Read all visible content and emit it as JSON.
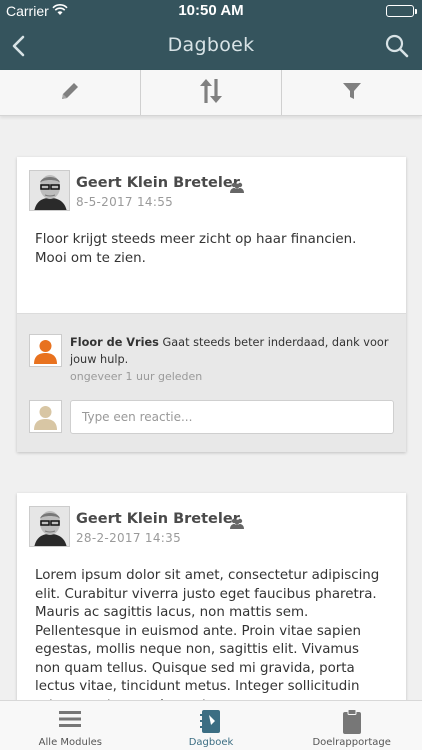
{
  "status_bar": {
    "carrier": "Carrier",
    "time": "10:50 AM",
    "battery_level": 1.0
  },
  "navbar": {
    "title": "Dagboek"
  },
  "colors": {
    "header": "#35545d",
    "accent": "#3c6e83",
    "success": "#4cd964"
  },
  "posts": [
    {
      "author": "Geert Klein Breteler",
      "date": "8-5-2017 14:55",
      "body": "Floor krijgt steeds meer zicht op haar financien. Mooi om te zien.",
      "comments": [
        {
          "author": "Floor de Vries",
          "text": "Gaat steeds beter inderdaad, dank voor jouw hulp.",
          "time": "ongeveer 1 uur geleden"
        }
      ],
      "reply_placeholder": "Type een reactie..."
    },
    {
      "author": "Geert Klein Breteler",
      "date": "28-2-2017 14:35",
      "body": "Lorem ipsum dolor sit amet, consectetur adipiscing elit. Curabitur viverra justo eget faucibus pharetra. Mauris ac sagittis lacus, non mattis sem. Pellentesque in euismod ante. Proin vitae sapien egestas, mollis neque non, sagittis elit. Vivamus non quam tellus. Quisque sed mi gravida, porta lectus vitae, tincidunt metus. Integer sollicitudin rutrum metus nec laoreet."
    }
  ],
  "tabbar": {
    "tabs": [
      {
        "label": "Alle Modules",
        "icon": "menu-icon"
      },
      {
        "label": "Dagboek",
        "icon": "notebook-icon",
        "active": true
      },
      {
        "label": "Doelrapportage",
        "icon": "clipboard-icon"
      }
    ]
  }
}
